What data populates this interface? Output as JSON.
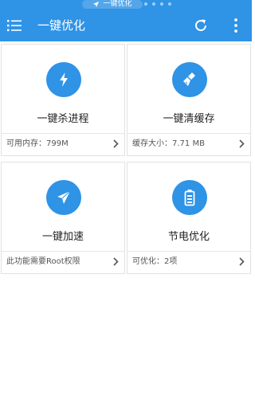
{
  "status_bar": {
    "notification_text": "一键优化"
  },
  "appbar": {
    "title": "一键优化",
    "icons": [
      "menu-icon",
      "refresh-icon",
      "more-vert-icon"
    ]
  },
  "colors": {
    "primary": "#2f93e6",
    "card_border": "#e2e2e2",
    "text": "#222222",
    "subtext": "#555555"
  },
  "cards": [
    {
      "title": "一键杀进程",
      "info": "可用内存：799M",
      "icon": "lightning-icon"
    },
    {
      "title": "一键清缓存",
      "info": "缓存大小：7.71 MB",
      "icon": "broom-icon"
    },
    {
      "title": "一键加速",
      "info": "此功能需要Root权限",
      "icon": "paper-plane-icon"
    },
    {
      "title": "节电优化",
      "info": "可优化：2项",
      "icon": "battery-icon"
    }
  ]
}
